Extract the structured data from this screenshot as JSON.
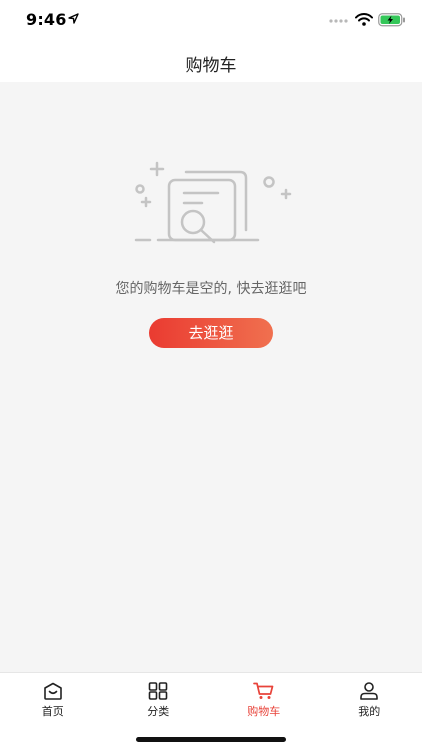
{
  "status_bar": {
    "time": "9:46"
  },
  "nav": {
    "title": "购物车"
  },
  "empty_state": {
    "message": "您的购物车是空的, 快去逛逛吧",
    "button_label": "去逛逛"
  },
  "tab_bar": {
    "items": [
      {
        "label": "首页",
        "icon": "home-icon"
      },
      {
        "label": "分类",
        "icon": "grid-icon"
      },
      {
        "label": "购物车",
        "icon": "cart-icon",
        "active": true
      },
      {
        "label": "我的",
        "icon": "user-icon"
      }
    ]
  },
  "colors": {
    "accent": "#e8433a",
    "button_start": "#ea3b31",
    "button_end": "#f0704f",
    "background": "#f5f5f5"
  }
}
